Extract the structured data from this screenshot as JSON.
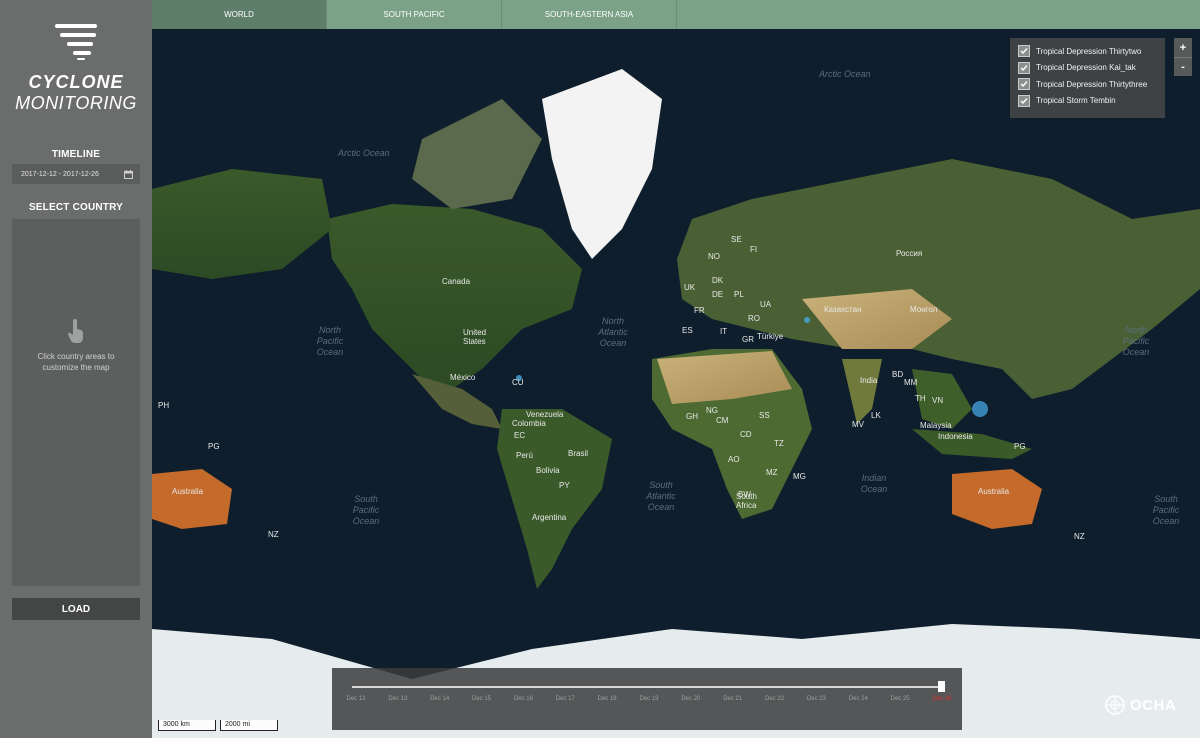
{
  "app": {
    "logo_line1": "CYCLONE",
    "logo_line2": "MONITORING"
  },
  "sidebar": {
    "timeline_title": "TIMELINE",
    "date_range": "2017-12-12 - 2017-12-26",
    "select_country_title": "SELECT COUNTRY",
    "country_hint": "Click country areas to customize the map",
    "load_label": "LOAD"
  },
  "tabs": [
    {
      "label": "WORLD",
      "active": true
    },
    {
      "label": "SOUTH PACIFIC",
      "active": false
    },
    {
      "label": "SOUTH-EASTERN ASIA",
      "active": false
    }
  ],
  "layers": [
    {
      "label": "Tropical Depression Thirtytwo",
      "checked": true
    },
    {
      "label": "Tropical Depression Kai_tak",
      "checked": true
    },
    {
      "label": "Tropical Depression Thirtythree",
      "checked": true
    },
    {
      "label": "Tropical Storm Tembin",
      "checked": true
    }
  ],
  "zoom": {
    "in_label": "+",
    "out_label": "-"
  },
  "timeline": {
    "ticks": [
      "Dec 12",
      "Dec 13",
      "Dec 14",
      "Dec 15",
      "Dec 16",
      "Dec 17",
      "Dec 18",
      "Dec 19",
      "Dec 20",
      "Dec 21",
      "Dec 22",
      "Dec 23",
      "Dec 24",
      "Dec 25",
      "Dec 26"
    ],
    "current_index": 14
  },
  "scale": {
    "metric": "3000 km",
    "imperial": "2000 mi"
  },
  "map_labels": {
    "canada": "Canada",
    "united_states": "United States",
    "mexico": "México",
    "cuba": "CU",
    "venezuela": "Venezuela",
    "colombia": "Colombia",
    "ecuador": "EC",
    "peru": "Perú",
    "brasil": "Brasil",
    "bolivia": "Bolivia",
    "paraguay": "PY",
    "argentina": "Argentina",
    "russia": "Россия",
    "kazakhstan": "Казахстан",
    "mongolia": "Монгол",
    "india": "India",
    "turkey": "Türkiye",
    "malaysia": "Malaysia",
    "indonesia": "Indonesia",
    "australia_left": "Australia",
    "australia_right": "Australia",
    "south_africa": "South Africa",
    "uk": "UK",
    "se": "SE",
    "fi": "FI",
    "no": "NO",
    "dk": "DK",
    "de": "DE",
    "pl": "PL",
    "fr": "FR",
    "ua": "UA",
    "es": "ES",
    "it": "IT",
    "ro": "RO",
    "gr": "GR",
    "cd": "CD",
    "ao": "AO",
    "tz": "TZ",
    "mz": "MZ",
    "bw": "BW",
    "mg": "MG",
    "ng": "NG",
    "gh": "GH",
    "cm": "CM",
    "ss": "SS",
    "lk": "LK",
    "mv": "MV",
    "bd": "BD",
    "mm": "MM",
    "th": "TH",
    "vn": "VN",
    "pg_left": "PG",
    "pg_right": "PG",
    "nz_left": "NZ",
    "nz_right": "NZ",
    "ph": "PH"
  },
  "ocean_labels": {
    "arctic_top": "Arctic Ocean",
    "arctic_left": "Arctic Ocean",
    "north_atlantic": "North Atlantic Ocean",
    "north_pacific_left": "North Pacific Ocean",
    "north_pacific_right": "North Pacific Ocean",
    "south_atlantic": "South Atlantic Ocean",
    "south_pacific_left": "South Pacific Ocean",
    "south_pacific_right": "South Pacific Ocean",
    "indian": "Indian Ocean"
  },
  "branding": {
    "ocha": "OCHA"
  },
  "colors": {
    "tab_bg": "#7ba187",
    "tab_active": "#5f7e69",
    "sidebar_bg": "#6b6d6d",
    "current_tick": "#e03030"
  }
}
